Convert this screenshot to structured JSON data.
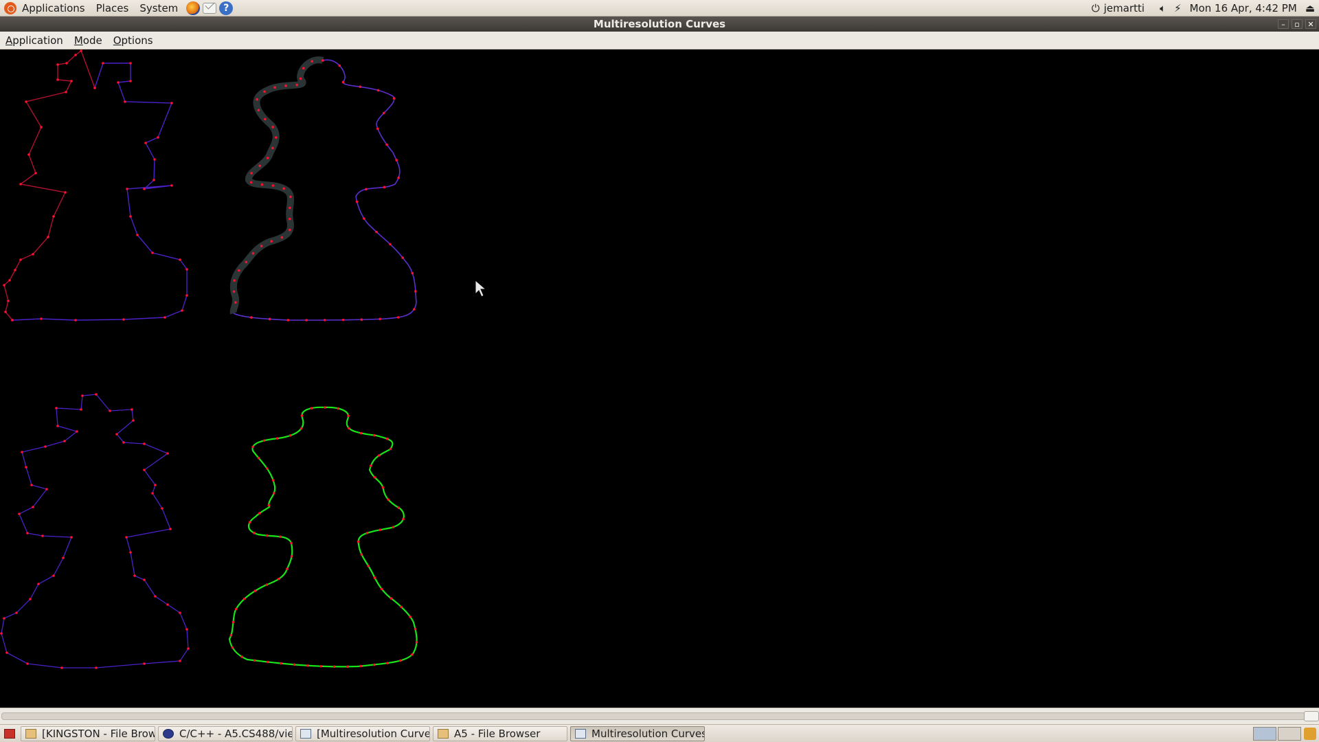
{
  "top_panel": {
    "menus": [
      "Applications",
      "Places",
      "System"
    ],
    "launchers": [
      "firefox-icon",
      "mail-icon",
      "help-icon"
    ],
    "help_glyph": "?",
    "user": "jemartti",
    "datetime": "Mon 16 Apr,  4:42 PM"
  },
  "window": {
    "title": "Multiresolution Curves",
    "controls": [
      "minimize",
      "maximize",
      "close"
    ],
    "menu": [
      {
        "label": "Application",
        "underline": "A",
        "rest": "pplication"
      },
      {
        "label": "Mode",
        "underline": "M",
        "rest": "ode"
      },
      {
        "label": "Options",
        "underline": "O",
        "rest": "ptions"
      }
    ]
  },
  "canvas": {
    "background": "#000000",
    "curve_colors": {
      "control_points": "#ff1030",
      "polyline_red": "#b01030",
      "polyline_blue": "#4a22c8",
      "thick_band": "#2b3434",
      "smooth_curve": "#19e619"
    }
  },
  "taskbar": {
    "tasks": [
      {
        "label": "[KINGSTON - File Brow...",
        "icon": "folder"
      },
      {
        "label": "C/C++ - A5.CS488/vie...",
        "icon": "eclipse"
      },
      {
        "label": "[Multiresolution Curves]",
        "icon": "window"
      },
      {
        "label": "A5 - File Browser",
        "icon": "folder"
      },
      {
        "label": "Multiresolution Curves",
        "icon": "window",
        "active": true
      }
    ]
  }
}
